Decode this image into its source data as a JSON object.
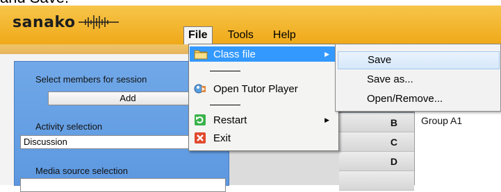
{
  "caption_fragment": "and Save.",
  "app": {
    "logo_text": "sanako"
  },
  "menubar": {
    "items": [
      "File",
      "Tools",
      "Help"
    ]
  },
  "left_panel": {
    "members_label": "Select members for session",
    "add_button": "Add",
    "activity_label": "Activity selection",
    "activity_value": "Discussion",
    "media_label": "Media source selection"
  },
  "grid": {
    "letters": [
      "B",
      "C",
      "D"
    ],
    "group_label": "Group A1"
  },
  "file_menu": {
    "class_file": "Class file",
    "open_tutor_player": "Open Tutor Player",
    "restart": "Restart",
    "exit": "Exit"
  },
  "class_file_submenu": {
    "items": [
      "Save",
      "Save as...",
      "Open/Remove..."
    ]
  },
  "colors": {
    "brand_orange": "#f0a919",
    "panel_blue": "#6aa2e6",
    "highlight_blue": "#3399ff"
  },
  "icons": {
    "class_file": "folder-icon",
    "tutor_player": "player-icon",
    "restart": "restart-icon",
    "exit": "exit-icon",
    "logo": "waveform-icon"
  }
}
